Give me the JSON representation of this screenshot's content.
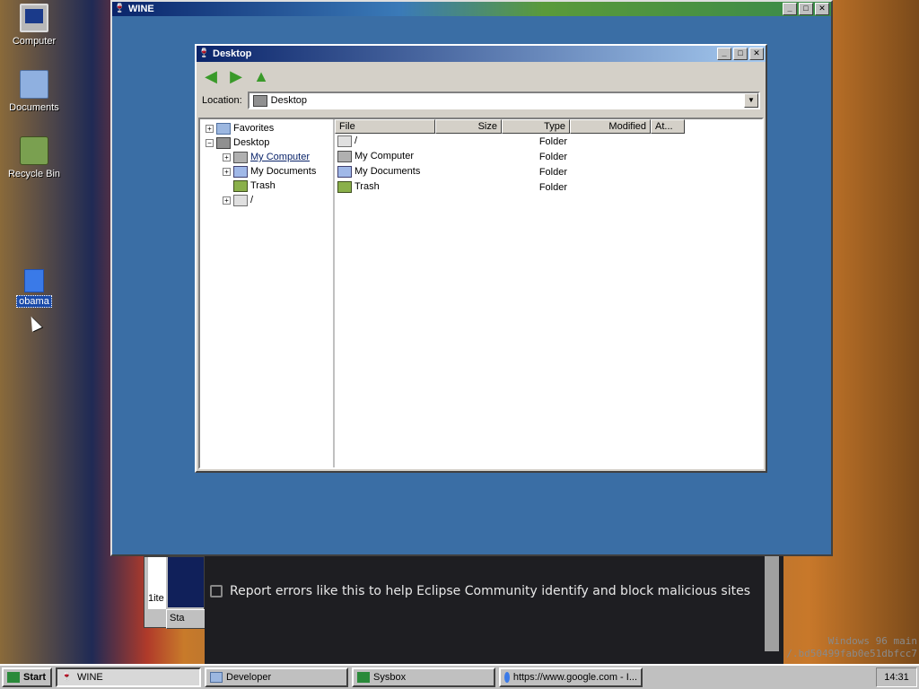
{
  "desktop": {
    "icons": [
      {
        "label": "Computer",
        "icon": "computer-icon"
      },
      {
        "label": "Documents",
        "icon": "folder-icon"
      },
      {
        "label": "Recycle Bin",
        "icon": "recycle-bin-icon"
      },
      {
        "label": "obama",
        "icon": "document-icon"
      }
    ]
  },
  "wine_window": {
    "title": "WINE",
    "buttons": [
      "_",
      "□",
      "✕"
    ]
  },
  "explorer": {
    "title": "Desktop",
    "location_label": "Location:",
    "location_value": "Desktop",
    "tree": [
      {
        "label": "Favorites",
        "expander": "+",
        "indent": 0,
        "icon": "folder-icon"
      },
      {
        "label": "Desktop",
        "expander": "−",
        "indent": 0,
        "icon": "desktop-icon"
      },
      {
        "label": "My Computer",
        "expander": "+",
        "indent": 1,
        "icon": "computer-icon",
        "selected": true
      },
      {
        "label": "My Documents",
        "expander": "+",
        "indent": 1,
        "icon": "documents-icon"
      },
      {
        "label": "Trash",
        "expander": "",
        "indent": 1,
        "icon": "trash-icon"
      },
      {
        "label": "/",
        "expander": "+",
        "indent": 1,
        "icon": "drive-icon"
      }
    ],
    "columns": [
      "File",
      "Size",
      "Type",
      "Modified",
      "At..."
    ],
    "rows": [
      {
        "file": "/",
        "size": "",
        "type": "Folder",
        "modified": "",
        "icon": "drive-icon"
      },
      {
        "file": "My Computer",
        "size": "",
        "type": "Folder",
        "modified": "",
        "icon": "computer-icon"
      },
      {
        "file": "My Documents",
        "size": "",
        "type": "Folder",
        "modified": "",
        "icon": "documents-icon"
      },
      {
        "file": "Trash",
        "size": "",
        "type": "Folder",
        "modified": "",
        "icon": "trash-icon"
      }
    ]
  },
  "background_browser": {
    "report_text": "Report errors like this to help Eclipse Community identify and block malicious sites",
    "left_fragment": "1ite",
    "left_button": "Sta"
  },
  "watermark": {
    "line1": "Windows 96 main",
    "line2": "/.bd50499fab0e51dbfcc7"
  },
  "taskbar": {
    "start_label": "Start",
    "items": [
      {
        "label": "WINE",
        "icon": "wine-icon",
        "active": true
      },
      {
        "label": "Developer",
        "icon": "folder-icon",
        "active": false
      },
      {
        "label": "Sysbox",
        "icon": "sysbox-icon",
        "active": false
      },
      {
        "label": "https://www.google.com - I...",
        "icon": "globe-icon",
        "active": false
      }
    ],
    "clock": "14:31"
  }
}
